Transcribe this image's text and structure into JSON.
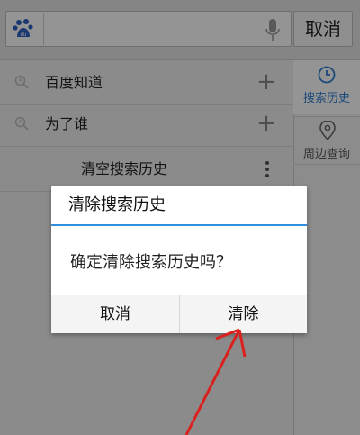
{
  "search": {
    "value": "",
    "placeholder": "",
    "cancel_label": "取消"
  },
  "history": {
    "items": [
      {
        "label": "百度知道"
      },
      {
        "label": "为了谁"
      }
    ],
    "clear_label": "清空搜索历史"
  },
  "side_panel": {
    "history_label": "搜索历史",
    "nearby_label": "周边查询"
  },
  "dialog": {
    "title": "清除搜索历史",
    "message": "确定清除搜索历史吗？",
    "cancel_label": "取消",
    "confirm_label": "清除"
  },
  "colors": {
    "accent_blue": "#2f8fdc",
    "annotation_red": "#d9211d"
  }
}
